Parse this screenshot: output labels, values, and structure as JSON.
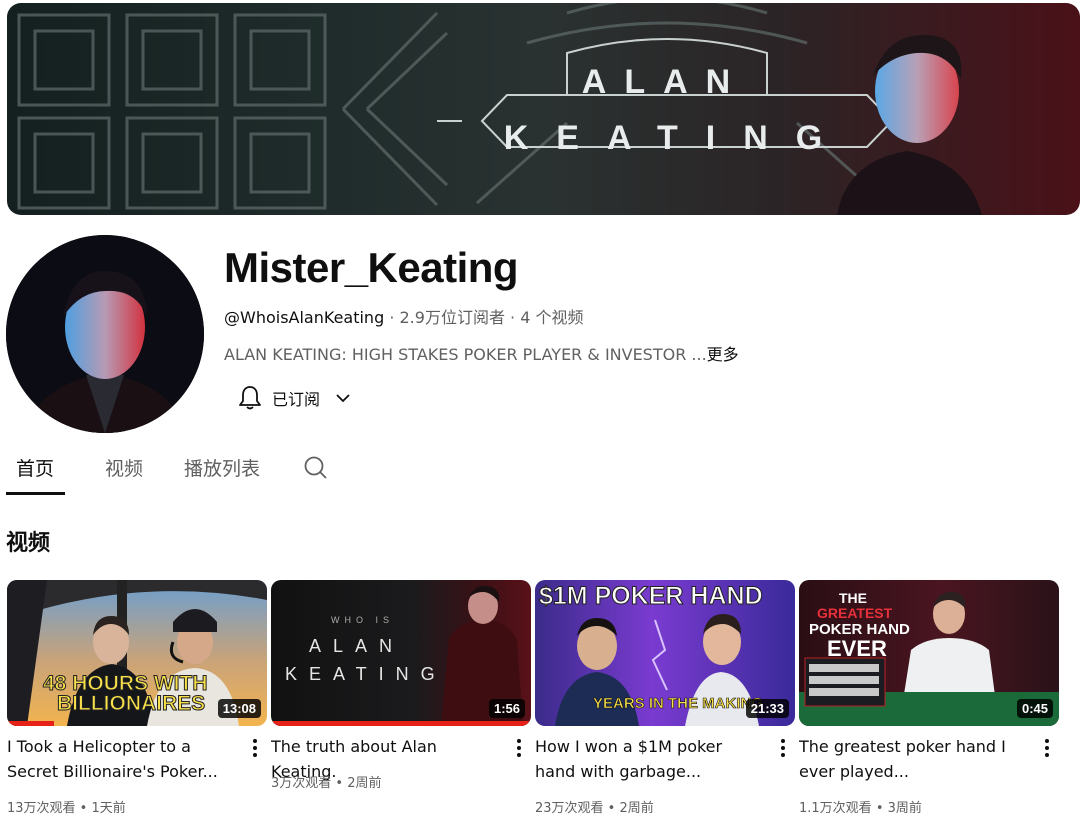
{
  "banner": {
    "title_line1": "ALAN",
    "title_line2": "KEATING"
  },
  "channel": {
    "name": "Mister_Keating",
    "handle": "@WhoisAlanKeating",
    "separator": " · ",
    "subscribers": "2.9万位订阅者",
    "video_count": "4 个视频",
    "description": "ALAN KEATING: HIGH STAKES POKER PLAYER & INVESTOR ...",
    "more_label": "更多",
    "subscribe_label": "已订阅"
  },
  "tabs": [
    {
      "label": "首页",
      "active": true
    },
    {
      "label": "视频",
      "active": false
    },
    {
      "label": "播放列表",
      "active": false
    }
  ],
  "section_title": "视频",
  "videos": [
    {
      "title": "I Took a Helicopter to a Secret Billionaire's Poker...",
      "duration": "13:08",
      "views": "13万次观看",
      "age": "1天前",
      "stats_sep": " • ",
      "watched_fraction": 0.18,
      "thumb_text_1": "48 HOURS WITH",
      "thumb_text_2": "BILLIONAIRES"
    },
    {
      "title": "The truth about Alan Keating.",
      "duration": "1:56",
      "views": "3万次观看",
      "age": "2周前",
      "stats_sep": " • ",
      "watched_fraction": 1.0,
      "thumb_text_1": "WHO IS",
      "thumb_text_2": "ALAN",
      "thumb_text_3": "KEATING"
    },
    {
      "title": "How I won a $1M poker hand with garbage...",
      "duration": "21:33",
      "views": "23万次观看",
      "age": "2周前",
      "stats_sep": " • ",
      "watched_fraction": 0,
      "thumb_text_1": "$1M POKER HAND",
      "thumb_text_2": "YEARS IN THE MAKING"
    },
    {
      "title": "The greatest poker hand I ever played...",
      "duration": "0:45",
      "views": "1.1万次观看",
      "age": "3周前",
      "stats_sep": " • ",
      "watched_fraction": 0,
      "thumb_text_1": "THE",
      "thumb_text_2": "GREATEST",
      "thumb_text_3": "POKER HAND",
      "thumb_text_4": "EVER"
    }
  ],
  "colors": {
    "accent_red": "#e62117",
    "text_primary": "#0f0f0f",
    "text_secondary": "#606060"
  }
}
